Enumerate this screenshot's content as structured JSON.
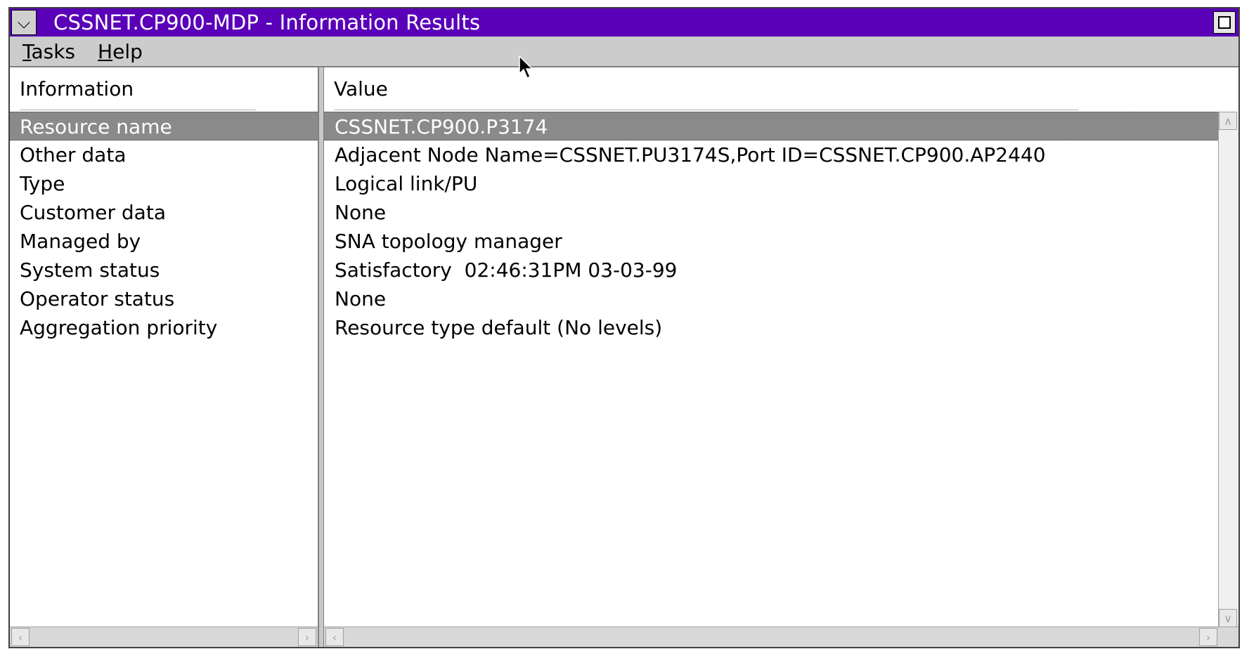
{
  "window": {
    "title": "CSSNET.CP900-MDP - Information Results",
    "sysmenu_icon": "⌵",
    "colors": {
      "titlebar": "#5a00b8",
      "selection": "#8a8a8a"
    }
  },
  "menubar": {
    "items": [
      {
        "mnemonic": "T",
        "rest": "asks"
      },
      {
        "mnemonic": "H",
        "rest": "elp"
      }
    ]
  },
  "table": {
    "headers": {
      "information": "Information",
      "value": "Value"
    },
    "rows": [
      {
        "info": "Resource name",
        "value": "CSSNET.CP900.P3174",
        "selected": true
      },
      {
        "info": "Other data",
        "value": "Adjacent Node Name=CSSNET.PU3174S,Port ID=CSSNET.CP900.AP2440"
      },
      {
        "info": "Type",
        "value": "Logical link/PU"
      },
      {
        "info": "Customer data",
        "value": "None"
      },
      {
        "info": "Managed by",
        "value": "SNA topology manager"
      },
      {
        "info": "System status",
        "value": "Satisfactory  02:46:31PM 03-03-99"
      },
      {
        "info": "Operator status",
        "value": "None"
      },
      {
        "info": "Aggregation priority",
        "value": "Resource type default (No levels)"
      }
    ]
  }
}
